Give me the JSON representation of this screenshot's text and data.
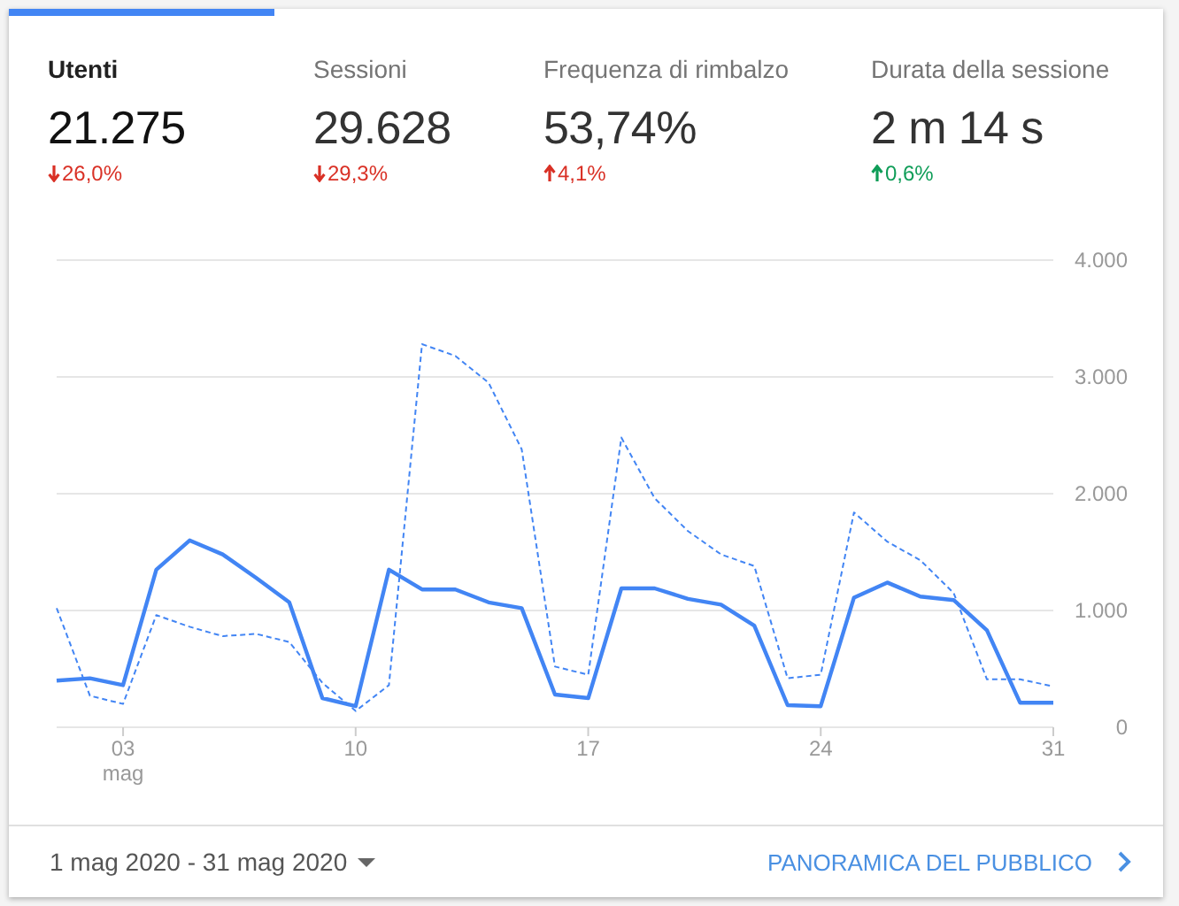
{
  "metrics": [
    {
      "title": "Utenti",
      "value": "21.275",
      "change": "26,0%",
      "kind": "down",
      "color": "#d93025",
      "selected": true
    },
    {
      "title": "Sessioni",
      "value": "29.628",
      "change": "29,3%",
      "kind": "down",
      "color": "#d93025",
      "selected": false
    },
    {
      "title": "Frequenza di rimbalzo",
      "value": "53,74%",
      "change": "4,1%",
      "kind": "up",
      "color": "#d93025",
      "selected": false
    },
    {
      "title": "Durata della sessione",
      "value": "2 m 14 s",
      "change": "0,6%",
      "kind": "up",
      "color": "#0f9d58",
      "selected": false
    }
  ],
  "chart": {
    "chart_data": {
      "type": "line",
      "x": [
        1,
        2,
        3,
        4,
        5,
        6,
        7,
        8,
        9,
        10,
        11,
        12,
        13,
        14,
        15,
        16,
        17,
        18,
        19,
        20,
        21,
        22,
        23,
        24,
        25,
        26,
        27,
        28,
        29,
        30,
        31
      ],
      "xticks": [
        {
          "value": 3,
          "label": "03"
        },
        {
          "value": 10,
          "label": "10"
        },
        {
          "value": 17,
          "label": "17"
        },
        {
          "value": 24,
          "label": "24"
        },
        {
          "value": 31,
          "label": "31"
        }
      ],
      "xlabel": "mag",
      "xlim": [
        1,
        31
      ],
      "grid": true,
      "ylim": [
        0,
        4000
      ],
      "yticks": [
        {
          "value": 0,
          "label": "0"
        },
        {
          "value": 1000,
          "label": "1.000"
        },
        {
          "value": 2000,
          "label": "2.000"
        },
        {
          "value": 3000,
          "label": "3.000"
        },
        {
          "value": 4000,
          "label": "4.000"
        }
      ],
      "series": [
        {
          "color": "#4285f4",
          "line_style": "solid",
          "values": [
            400,
            420,
            360,
            1350,
            1600,
            1480,
            1280,
            1070,
            250,
            180,
            1350,
            1180,
            1180,
            1070,
            1020,
            280,
            250,
            1190,
            1190,
            1100,
            1050,
            870,
            190,
            180,
            1110,
            1240,
            1120,
            1090,
            830,
            210,
            210
          ]
        },
        {
          "color": "#4285f4",
          "line_style": "dashed",
          "values": [
            1020,
            270,
            200,
            960,
            860,
            780,
            800,
            730,
            380,
            140,
            360,
            3280,
            3180,
            2950,
            2380,
            520,
            450,
            2480,
            1960,
            1680,
            1480,
            1380,
            420,
            450,
            1840,
            1590,
            1430,
            1150,
            410,
            410,
            350
          ]
        }
      ]
    }
  },
  "footer": {
    "date_range": "1 mag 2020 - 31 mag 2020",
    "link": "PANORAMICA DEL PUBBLICO"
  }
}
